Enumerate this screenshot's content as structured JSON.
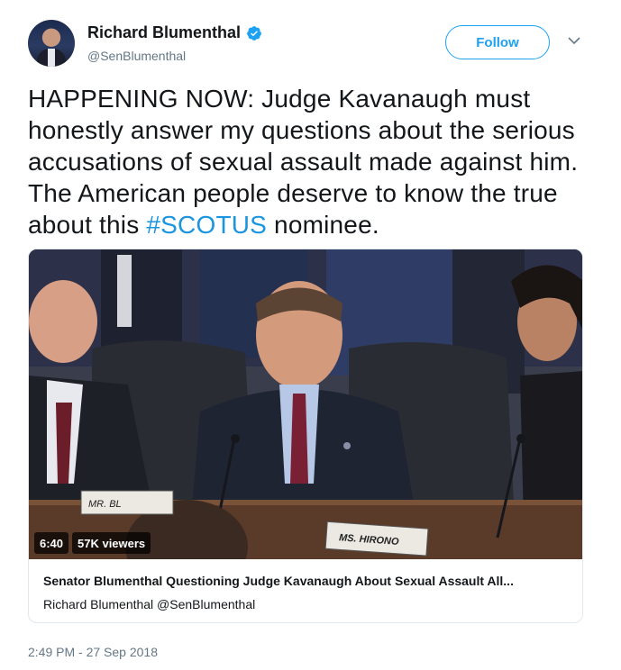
{
  "author": {
    "name": "Richard Blumenthal",
    "handle": "@SenBlumenthal",
    "verified": true,
    "avatar_icon": "avatar-portrait"
  },
  "actions": {
    "follow_label": "Follow",
    "menu_icon": "chevron-down-icon"
  },
  "tweet": {
    "text_before": "HAPPENING NOW: Judge Kavanaugh must honestly answer my questions about the serious accusations of sexual assault made against him. The American people deserve to know the true about this ",
    "hashtag": "#SCOTUS",
    "text_after": " nominee.",
    "timestamp": "2:49 PM - 27 Sep 2018"
  },
  "media": {
    "duration": "6:40",
    "viewers": "57K viewers",
    "nameplate_left": "MR. BL",
    "nameplate_right": "MS. HIRONO"
  },
  "card": {
    "title": "Senator Blumenthal Questioning Judge Kavanaugh About Sexual Assault All...",
    "byline": "Richard Blumenthal @SenBlumenthal"
  },
  "colors": {
    "accent": "#1da1f2",
    "hashtag": "#1b95e0",
    "secondary_text": "#657786"
  }
}
